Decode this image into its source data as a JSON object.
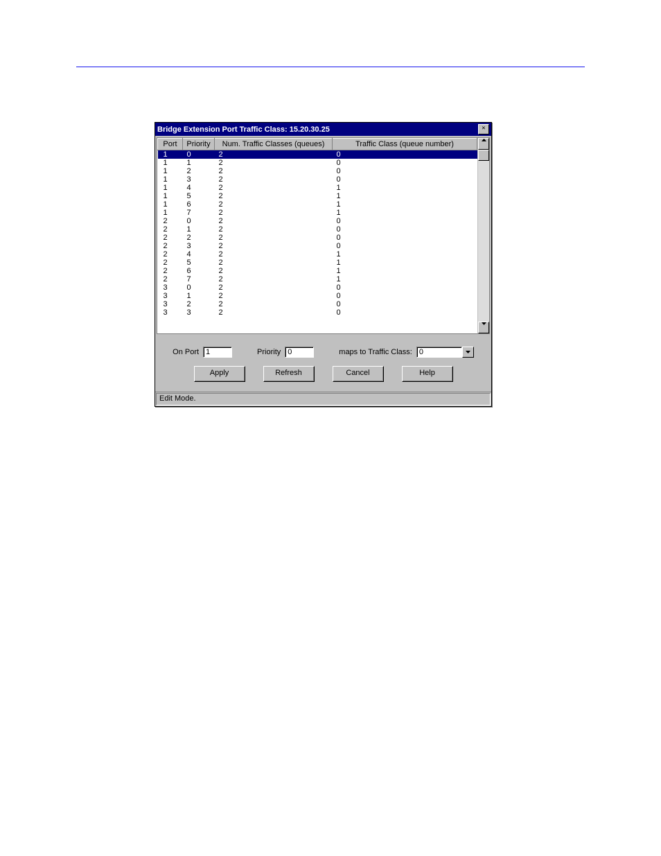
{
  "dialog": {
    "title": "Bridge Extension Port Traffic Class: 15.20.30.25",
    "columns": {
      "port": "Port",
      "priority": "Priority",
      "num_queues": "Num. Traffic Classes (queues)",
      "traffic_class": "Traffic Class (queue number)"
    },
    "rows": [
      {
        "port": "1",
        "priority": "0",
        "numq": "2",
        "tc": "0",
        "selected": true
      },
      {
        "port": "1",
        "priority": "1",
        "numq": "2",
        "tc": "0"
      },
      {
        "port": "1",
        "priority": "2",
        "numq": "2",
        "tc": "0"
      },
      {
        "port": "1",
        "priority": "3",
        "numq": "2",
        "tc": "0"
      },
      {
        "port": "1",
        "priority": "4",
        "numq": "2",
        "tc": "1"
      },
      {
        "port": "1",
        "priority": "5",
        "numq": "2",
        "tc": "1"
      },
      {
        "port": "1",
        "priority": "6",
        "numq": "2",
        "tc": "1"
      },
      {
        "port": "1",
        "priority": "7",
        "numq": "2",
        "tc": "1"
      },
      {
        "port": "2",
        "priority": "0",
        "numq": "2",
        "tc": "0"
      },
      {
        "port": "2",
        "priority": "1",
        "numq": "2",
        "tc": "0"
      },
      {
        "port": "2",
        "priority": "2",
        "numq": "2",
        "tc": "0"
      },
      {
        "port": "2",
        "priority": "3",
        "numq": "2",
        "tc": "0"
      },
      {
        "port": "2",
        "priority": "4",
        "numq": "2",
        "tc": "1"
      },
      {
        "port": "2",
        "priority": "5",
        "numq": "2",
        "tc": "1"
      },
      {
        "port": "2",
        "priority": "6",
        "numq": "2",
        "tc": "1"
      },
      {
        "port": "2",
        "priority": "7",
        "numq": "2",
        "tc": "1"
      },
      {
        "port": "3",
        "priority": "0",
        "numq": "2",
        "tc": "0"
      },
      {
        "port": "3",
        "priority": "1",
        "numq": "2",
        "tc": "0"
      },
      {
        "port": "3",
        "priority": "2",
        "numq": "2",
        "tc": "0"
      },
      {
        "port": "3",
        "priority": "3",
        "numq": "2",
        "tc": "0"
      }
    ],
    "form": {
      "on_port_label": "On Port",
      "on_port_value": "1",
      "priority_label": "Priority",
      "priority_value": "0",
      "maps_label": "maps to Traffic Class:",
      "traffic_class_value": "0"
    },
    "buttons": {
      "apply": "Apply",
      "refresh": "Refresh",
      "cancel": "Cancel",
      "help": "Help"
    },
    "status": "Edit Mode."
  }
}
